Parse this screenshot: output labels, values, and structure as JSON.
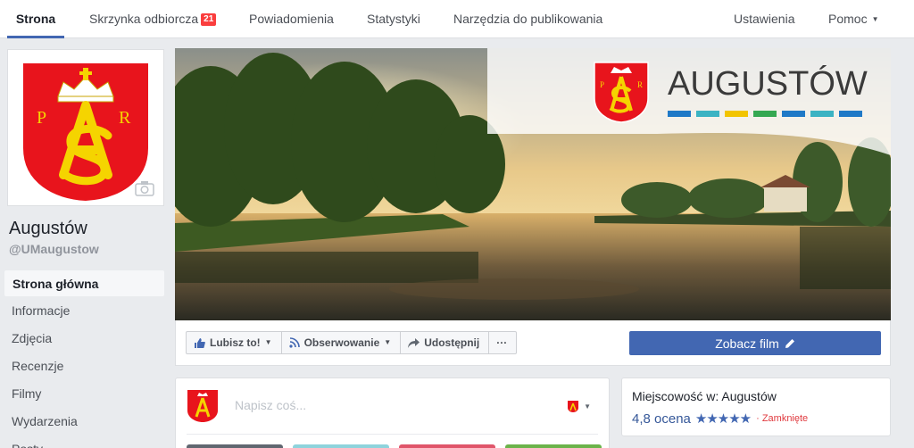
{
  "topnav": {
    "tabs": [
      {
        "label": "Strona"
      },
      {
        "label": "Skrzynka odbiorcza"
      },
      {
        "label": "Powiadomienia"
      },
      {
        "label": "Statystyki"
      },
      {
        "label": "Narzędzia do publikowania"
      },
      {
        "label": "Ustawienia"
      },
      {
        "label": "Pomoc"
      }
    ],
    "inbox_badge": "21"
  },
  "page": {
    "name": "Augustów",
    "handle": "@UMaugustow"
  },
  "leftnav": {
    "items": [
      {
        "label": "Strona główna"
      },
      {
        "label": "Informacje"
      },
      {
        "label": "Zdjęcia"
      },
      {
        "label": "Recenzje"
      },
      {
        "label": "Filmy"
      },
      {
        "label": "Wydarzenia"
      },
      {
        "label": "Posty"
      }
    ]
  },
  "cover": {
    "brand_text": "AUGUSTÓW",
    "crest_letters": [
      "P",
      "R"
    ]
  },
  "actions": {
    "like": "Lubisz to!",
    "follow": "Obserwowanie",
    "share": "Udostępnij",
    "more": "···",
    "watch_video": "Zobacz film"
  },
  "composer": {
    "placeholder": "Napisz coś..."
  },
  "about": {
    "category": "Miejscowość w: Augustów",
    "rating": "4,8 ocena",
    "stars": "★★★★★",
    "status": "Zamknięte"
  },
  "colors": {
    "accent": "#4267b2",
    "badge": "#fa3e3e",
    "crest_red": "#e8141c",
    "crest_gold": "#f5d400"
  }
}
